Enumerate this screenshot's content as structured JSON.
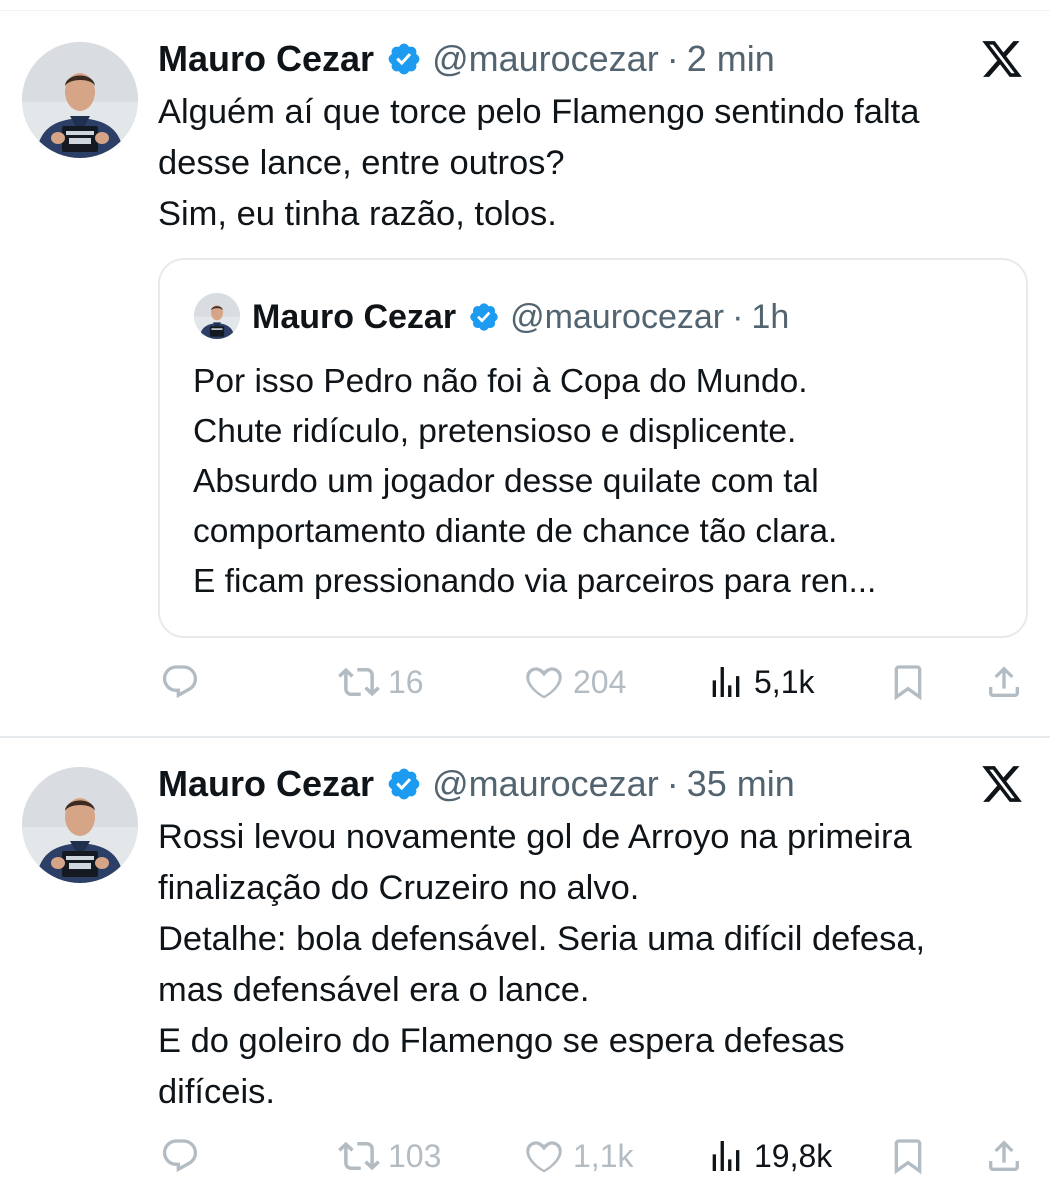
{
  "tweets": [
    {
      "author": {
        "name": "Mauro Cezar",
        "handle": "@maurocezar",
        "verified_icon": "verified-badge-icon",
        "avatar_icon": "avatar"
      },
      "time": "2 min",
      "text_lines": [
        "Alguém aí que torce pelo Flamengo sentindo falta",
        "desse lance, entre outros?",
        "Sim, eu tinha razão, tolos."
      ],
      "quote": {
        "author": {
          "name": "Mauro Cezar",
          "handle": "@maurocezar"
        },
        "time": "1h",
        "text_lines": [
          "Por isso Pedro não foi à Copa do Mundo.",
          "Chute ridículo, pretensioso e displicente.",
          "Absurdo um jogador desse quilate com tal",
          "comportamento diante de chance tão clara.",
          "E ficam pressionando via parceiros para ren..."
        ]
      },
      "actions": {
        "replies_icon": "reply-icon",
        "retweets_icon": "retweet-icon",
        "retweets": "16",
        "likes_icon": "heart-icon",
        "likes": "204",
        "views_icon": "views-icon",
        "views": "5,1k",
        "bookmark_icon": "bookmark-icon",
        "share_icon": "share-icon"
      }
    },
    {
      "author": {
        "name": "Mauro Cezar",
        "handle": "@maurocezar",
        "verified_icon": "verified-badge-icon",
        "avatar_icon": "avatar"
      },
      "time": "35 min",
      "text_lines": [
        "Rossi levou novamente gol de Arroyo na primeira",
        "finalização do Cruzeiro no alvo.",
        "Detalhe: bola defensável. Seria uma difícil defesa,",
        "mas defensável era o lance.",
        "E do goleiro do Flamengo se espera defesas",
        "difíceis."
      ],
      "actions": {
        "replies_icon": "reply-icon",
        "retweets_icon": "retweet-icon",
        "retweets": "103",
        "likes_icon": "heart-icon",
        "likes": "1,1k",
        "views_icon": "views-icon",
        "views": "19,8k",
        "bookmark_icon": "bookmark-icon",
        "share_icon": "share-icon"
      }
    }
  ],
  "colors": {
    "text": "#0f1419",
    "secondary": "#536471",
    "muted_icon": "#b3bcc3",
    "verified": "#1d9bf0",
    "border": "#e6eaec"
  }
}
